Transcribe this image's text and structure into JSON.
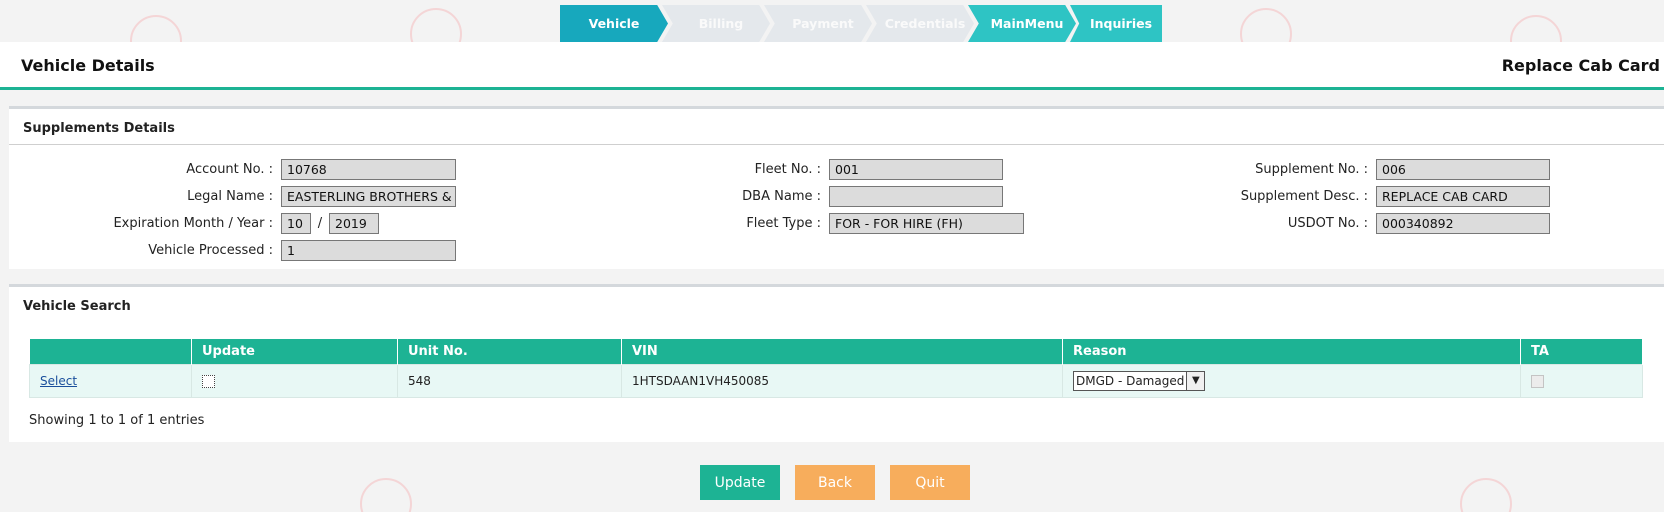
{
  "steps": [
    "Vehicle",
    "Billing",
    "Payment",
    "Credentials",
    "MainMenu",
    "Inquiries"
  ],
  "header": {
    "title": "Vehicle Details",
    "right_title": "Replace Cab Card"
  },
  "supplements": {
    "title": "Supplements Details",
    "account_no_label": "Account No. :",
    "account_no": "10768",
    "legal_name_label": "Legal Name :",
    "legal_name": "EASTERLING BROTHERS & S",
    "expiration_label": "Expiration Month / Year :",
    "exp_month": "10",
    "exp_sep": "/",
    "exp_year": "2019",
    "vehicle_processed_label": "Vehicle Processed :",
    "vehicle_processed": "1",
    "fleet_no_label": "Fleet No. :",
    "fleet_no": "001",
    "dba_name_label": "DBA Name :",
    "dba_name": "",
    "fleet_type_label": "Fleet Type :",
    "fleet_type": "FOR - FOR HIRE (FH)",
    "supplement_no_label": "Supplement No. :",
    "supplement_no": "006",
    "supplement_desc_label": "Supplement Desc. :",
    "supplement_desc": "REPLACE CAB CARD",
    "usdot_label": "USDOT No. :",
    "usdot": "000340892"
  },
  "vehicle_search": {
    "title": "Vehicle Search",
    "columns": [
      "",
      "Update",
      "Unit No.",
      "VIN",
      "Reason",
      "TA"
    ],
    "rows": [
      {
        "select": "Select",
        "unit_no": "548",
        "vin": "1HTSDAAN1VH450085",
        "reason": "DMGD - Damaged"
      }
    ],
    "showing": "Showing 1 to 1 of 1 entries"
  },
  "buttons": {
    "update": "Update",
    "back": "Back",
    "quit": "Quit"
  },
  "colors": {
    "accent": "#1db394",
    "step_active": "#17a8bd",
    "orange": "#f7ad5c"
  }
}
